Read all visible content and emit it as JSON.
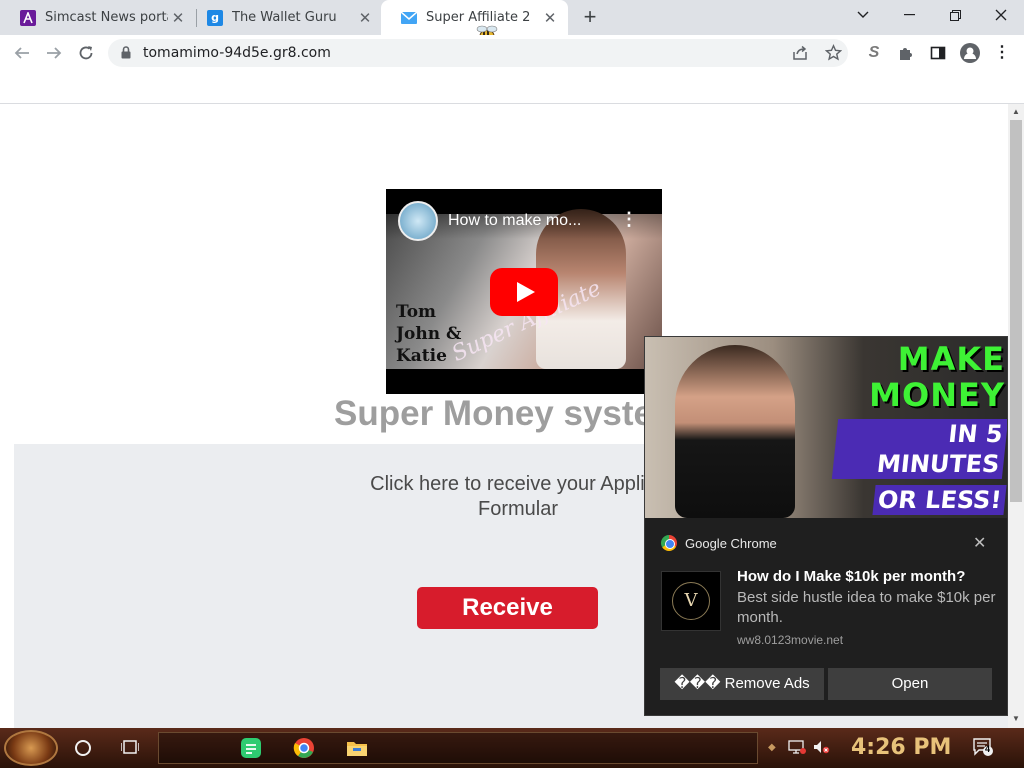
{
  "browser": {
    "tabs": [
      {
        "title": "Simcast News portal.",
        "favicon_color": "#6a1b9a",
        "active": false
      },
      {
        "title": "The Wallet Guru",
        "favicon_color": "#1e88e5",
        "favicon_letter": "g",
        "active": false
      },
      {
        "title": "Super Affiliate 2",
        "favicon_color": "#42a5f5",
        "active": true
      }
    ],
    "new_tab_icon": "plus-icon",
    "window_controls": [
      "chevron-down-icon",
      "minimize-icon",
      "restore-icon",
      "close-icon"
    ],
    "url": "tomamimo-94d5e.gr8.com"
  },
  "page": {
    "video": {
      "title": "How to make mo...",
      "names_line1": "Tom",
      "names_line2": "John &",
      "names_line3": "Katie",
      "brand_text": "Super Affiliate"
    },
    "heading": "Super Money syste",
    "cta_line1": "Click here to receive your Applica",
    "cta_line2": "Formular",
    "receive_label": "Receive"
  },
  "notification": {
    "app_name": "Google Chrome",
    "hero_line1": "MAKE",
    "hero_line2": "MONEY",
    "hero_line3": "IN 5 MINUTES",
    "hero_line4": "OR LESS!",
    "thumb_text": "V",
    "title": "How do I Make $10k per month?",
    "body": "Best side hustle idea to make $10k per month.",
    "source": "ww8.0123movie.net",
    "btn_remove": "��� Remove Ads",
    "btn_open": "Open"
  },
  "taskbar": {
    "clock": "4:26 PM",
    "notif_count": "4"
  },
  "colors": {
    "accent_red": "#d71c2c",
    "promo_green": "#3ef235",
    "promo_purple": "#4b2bb4"
  }
}
